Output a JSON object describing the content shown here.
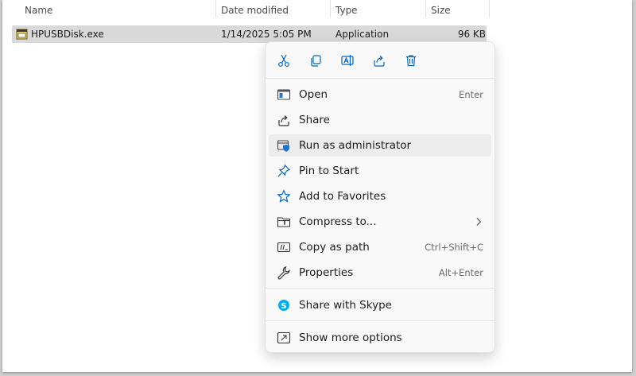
{
  "columns": {
    "name": "Name",
    "date_modified": "Date modified",
    "type": "Type",
    "size": "Size"
  },
  "file": {
    "name": "HPUSBDisk.exe",
    "date_modified": "1/14/2025 5:05 PM",
    "type": "Application",
    "size": "96 KB"
  },
  "context_menu": {
    "toolbar": [
      "cut-icon",
      "copy-icon",
      "rename-icon",
      "share-icon",
      "delete-icon"
    ],
    "items": [
      {
        "label": "Open",
        "accelerator": "Enter",
        "icon": "open-window-icon"
      },
      {
        "label": "Share",
        "accelerator": "",
        "icon": "share-icon"
      },
      {
        "label": "Run as administrator",
        "accelerator": "",
        "icon": "shield-window-icon"
      },
      {
        "label": "Pin to Start",
        "accelerator": "",
        "icon": "pin-icon"
      },
      {
        "label": "Add to Favorites",
        "accelerator": "",
        "icon": "star-icon"
      },
      {
        "label": "Compress to...",
        "accelerator": "",
        "icon": "zip-folder-icon"
      },
      {
        "label": "Copy as path",
        "accelerator": "Ctrl+Shift+C",
        "icon": "copy-path-icon"
      },
      {
        "label": "Properties",
        "accelerator": "Alt+Enter",
        "icon": "wrench-icon"
      },
      {
        "label": "Share with Skype",
        "accelerator": "",
        "icon": "skype-icon"
      },
      {
        "label": "Show more options",
        "accelerator": "",
        "icon": "more-options-icon"
      }
    ]
  },
  "colors": {
    "accent": "#0067c0",
    "selection": "#d9d9d9",
    "menu_bg": "#f9f9f9",
    "skype": "#00aff0"
  }
}
